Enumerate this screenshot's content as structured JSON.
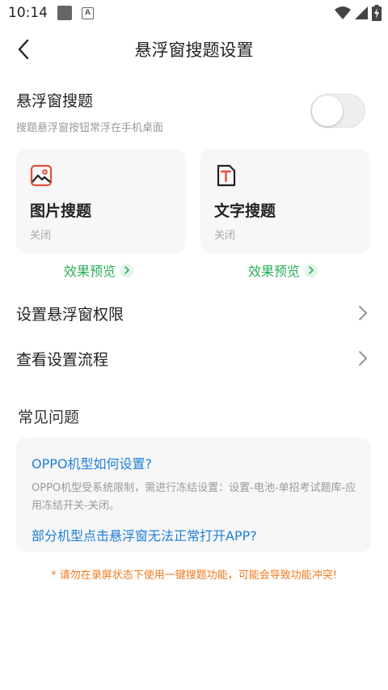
{
  "status_bar": {
    "time": "10:14",
    "icons": [
      "notification-square-icon",
      "keyboard-a-icon",
      "wifi-icon",
      "signal-icon",
      "battery-charging-icon"
    ]
  },
  "nav": {
    "back_icon": "chevron-left-icon",
    "title": "悬浮窗搜题设置"
  },
  "float_setting": {
    "title": "悬浮窗搜题",
    "subtitle": "搜题悬浮窗按钮常浮在手机桌面",
    "toggle_on": false
  },
  "cards": [
    {
      "icon": "image-icon",
      "title": "图片搜题",
      "status": "关闭",
      "preview_label": "效果预览"
    },
    {
      "icon": "text-t-icon",
      "title": "文字搜题",
      "status": "关闭",
      "preview_label": "效果预览"
    }
  ],
  "list": [
    {
      "label": "设置悬浮窗权限"
    },
    {
      "label": "查看设置流程"
    }
  ],
  "faq": {
    "heading": "常见问题",
    "items": [
      {
        "question": "OPPO机型如何设置?",
        "answer": "OPPO机型受系统限制，需进行冻结设置：设置-电池-单招考试题库-应用冻结开关-关闭。"
      },
      {
        "question": "部分机型点击悬浮窗无法正常打开APP?"
      }
    ]
  },
  "warning": "* 请勿在录屏状态下使用一键搜题功能，可能会导致功能冲突!",
  "colors": {
    "accent_green": "#2aae5a",
    "link_blue": "#1e7fd6",
    "warning_orange": "#f07a1e",
    "card_bg": "#f7f7f7"
  }
}
